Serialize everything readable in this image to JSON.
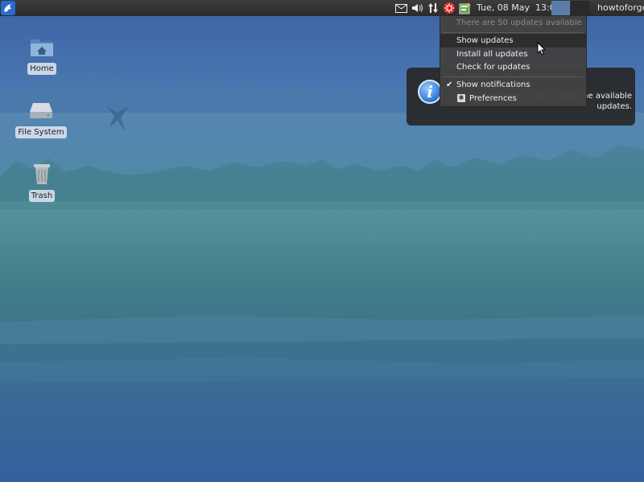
{
  "panel": {
    "clock": "Tue, 08 May  13:09",
    "user": "howtoforge",
    "tray_icons": [
      "mail-icon",
      "volume-icon",
      "network-icon",
      "update-alert-icon",
      "package-updater-icon"
    ]
  },
  "desktop": {
    "icons": [
      {
        "label": "Home",
        "icon": "home-folder-icon"
      },
      {
        "label": "File System",
        "icon": "drive-icon"
      },
      {
        "label": "Trash",
        "icon": "trash-icon"
      }
    ]
  },
  "menu": {
    "header": "There are 50 updates available",
    "items": [
      {
        "label": "Show updates"
      },
      {
        "label": "Install all updates"
      },
      {
        "label": "Check for updates"
      },
      {
        "label": "Show notifications",
        "checked": true
      },
      {
        "label": "Preferences"
      }
    ]
  },
  "notification": {
    "text": "on the notification icon to show the available updates."
  },
  "colors": {
    "panel": "#2f2f2f",
    "menu_bg": "#424242",
    "menu_highlight": "#2d2d2d",
    "notify_bg": "#282828",
    "info_blue": "#2f7ad8"
  }
}
